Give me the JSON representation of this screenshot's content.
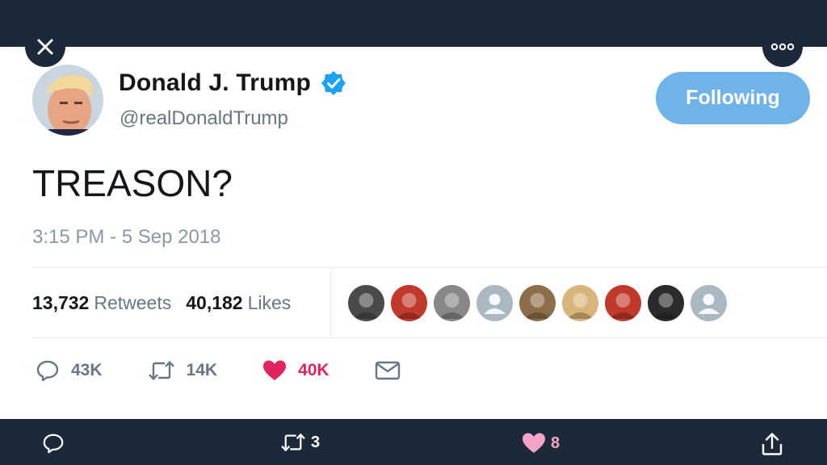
{
  "colors": {
    "brand_blue": "#1da1f2",
    "follow_bg": "#6fb3e9",
    "like": "#e0245e",
    "bar_bg": "#1c2938"
  },
  "tweet": {
    "author_name": "Donald J. Trump",
    "author_handle": "@realDonaldTrump",
    "follow_label": "Following",
    "text": "TREASON?",
    "timestamp": "3:15 PM - 5 Sep 2018",
    "retweets_count": "13,732",
    "retweets_label": "Retweets",
    "likes_count": "40,182",
    "likes_label": "Likes"
  },
  "likers": [
    {
      "icon": "avatar-photo",
      "color": "#4a4a4a"
    },
    {
      "icon": "avatar-photo",
      "color": "#c0392b"
    },
    {
      "icon": "avatar-photo",
      "color": "#888888"
    },
    {
      "icon": "default-avatar",
      "color": "#aab8c2"
    },
    {
      "icon": "avatar-photo",
      "color": "#8d6e4a"
    },
    {
      "icon": "avatar-photo",
      "color": "#d8b57a"
    },
    {
      "icon": "avatar-photo",
      "color": "#c0392b"
    },
    {
      "icon": "avatar-photo",
      "color": "#2b2b2b"
    },
    {
      "icon": "default-avatar",
      "color": "#aab8c2"
    }
  ],
  "actions": {
    "replies": "43K",
    "retweets": "14K",
    "likes": "40K"
  },
  "bottom_bar": {
    "retweets": "3",
    "likes": "8"
  },
  "icons": [
    "close-icon",
    "more-icon",
    "verified-icon",
    "reply-icon",
    "retweet-icon",
    "heart-icon",
    "message-icon",
    "share-icon"
  ]
}
